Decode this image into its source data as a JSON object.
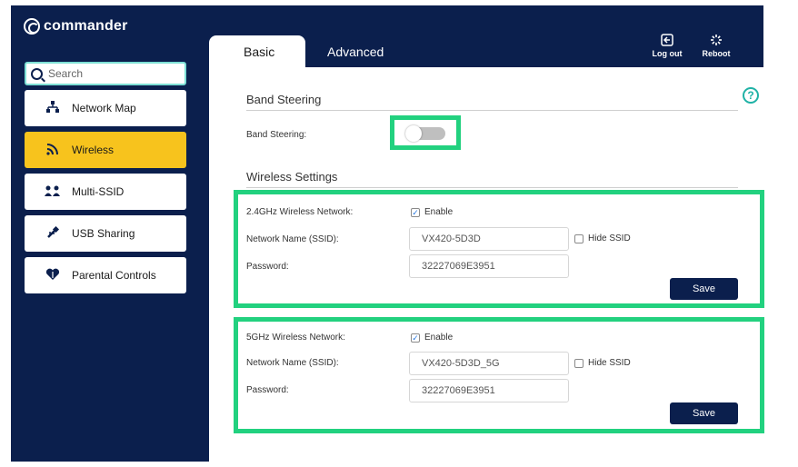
{
  "app": {
    "brand": "commander"
  },
  "header": {
    "logout_label": "Log out",
    "reboot_label": "Reboot",
    "logout_icon": "logout-icon",
    "reboot_icon": "reboot-icon"
  },
  "search": {
    "placeholder": "Search"
  },
  "sidebar": {
    "items": [
      {
        "label": "Network Map",
        "icon": "network-map-icon"
      },
      {
        "label": "Wireless",
        "icon": "wireless-icon",
        "active": true
      },
      {
        "label": "Multi-SSID",
        "icon": "multi-ssid-icon"
      },
      {
        "label": "USB Sharing",
        "icon": "usb-icon"
      },
      {
        "label": "Parental Controls",
        "icon": "heart-shield-icon"
      }
    ]
  },
  "tabs": [
    {
      "label": "Basic",
      "active": true
    },
    {
      "label": "Advanced",
      "active": false
    }
  ],
  "band_steering": {
    "section_title": "Band Steering",
    "label": "Band Steering:",
    "enabled": false
  },
  "wireless_settings": {
    "section_title": "Wireless Settings",
    "networks": [
      {
        "band_label": "2.4GHz Wireless Network:",
        "enable_label": "Enable",
        "enabled": true,
        "ssid_label": "Network Name (SSID):",
        "ssid_value": "VX420-5D3D",
        "hide_ssid_label": "Hide SSID",
        "hide_ssid": false,
        "password_label": "Password:",
        "password_value": "32227069E3951",
        "save_label": "Save"
      },
      {
        "band_label": "5GHz Wireless Network:",
        "enable_label": "Enable",
        "enabled": true,
        "ssid_label": "Network Name (SSID):",
        "ssid_value": "VX420-5D3D_5G",
        "hide_ssid_label": "Hide SSID",
        "hide_ssid": false,
        "password_label": "Password:",
        "password_value": "32227069E3951",
        "save_label": "Save"
      }
    ]
  },
  "colors": {
    "navy": "#0b1f4d",
    "active_yellow": "#f7c31d",
    "highlight_green": "#22d17f",
    "help_teal": "#20b2a6"
  }
}
